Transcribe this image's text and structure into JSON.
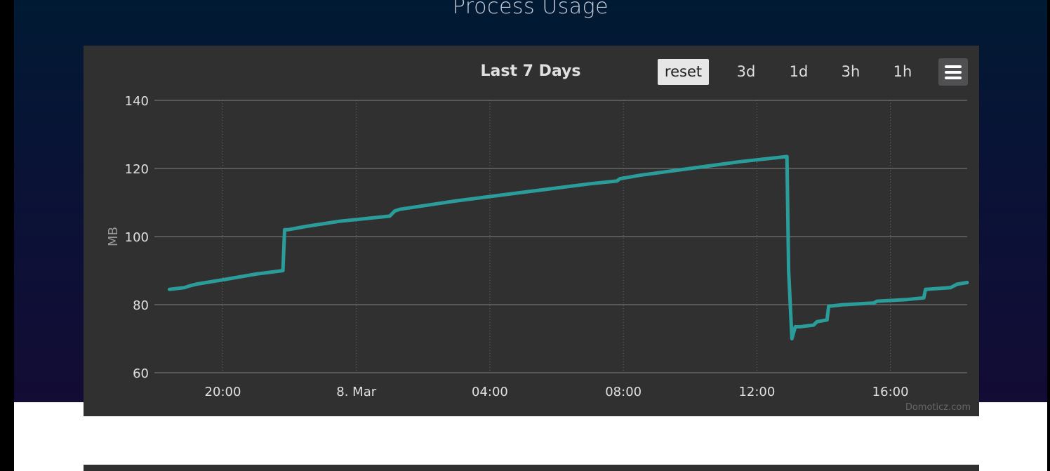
{
  "section_title": "Process Usage",
  "chart": {
    "title": "Last 7 Days",
    "buttons": [
      "reset",
      "3d",
      "1d",
      "3h",
      "1h"
    ],
    "menu_icon": "hamburger-menu-icon",
    "credit": "Domoticz.com"
  },
  "colors": {
    "panel": "#303030",
    "line": "#2a9d9b",
    "grid": "#707070",
    "text": "#e0e0e3"
  },
  "chart_data": {
    "type": "line",
    "title": "Last 7 Days",
    "xlabel": "",
    "ylabel": "MB",
    "x_ticks": [
      "20:00",
      "8. Mar",
      "04:00",
      "08:00",
      "12:00",
      "16:00"
    ],
    "x_tick_hours": [
      20,
      24,
      28,
      32,
      36,
      40
    ],
    "y_ticks": [
      60,
      80,
      100,
      120,
      140
    ],
    "ylim": [
      60,
      140
    ],
    "xlim_hours": [
      17.95,
      42.3
    ],
    "grid": true,
    "legend": "none",
    "series": [
      {
        "name": "",
        "color": "#2a9d9b",
        "x_hours": [
          18.4,
          18.85,
          19.0,
          19.2,
          19.5,
          20.0,
          21.0,
          21.8,
          21.85,
          21.95,
          22.5,
          23.5,
          25.0,
          25.15,
          25.3,
          27.0,
          29.0,
          31.0,
          31.8,
          31.9,
          32.5,
          34.0,
          35.5,
          36.9,
          36.95,
          37.05,
          37.15,
          37.3,
          37.7,
          37.8,
          38.1,
          38.15,
          38.6,
          38.65,
          39.5,
          39.6,
          40.5,
          41.0,
          41.05,
          41.8,
          42.0,
          42.3
        ],
        "values": [
          84.5,
          85.0,
          85.5,
          86.0,
          86.5,
          87.3,
          89.0,
          90.0,
          102.0,
          102.0,
          103.0,
          104.5,
          106.0,
          107.5,
          108.0,
          110.5,
          113.0,
          115.5,
          116.3,
          117.0,
          118.0,
          120.0,
          122.0,
          123.5,
          90.0,
          70.0,
          73.5,
          73.5,
          74.0,
          75.0,
          75.5,
          79.5,
          80.0,
          80.0,
          80.5,
          81.0,
          81.5,
          82.0,
          84.5,
          85.0,
          86.0,
          86.5
        ]
      }
    ]
  }
}
